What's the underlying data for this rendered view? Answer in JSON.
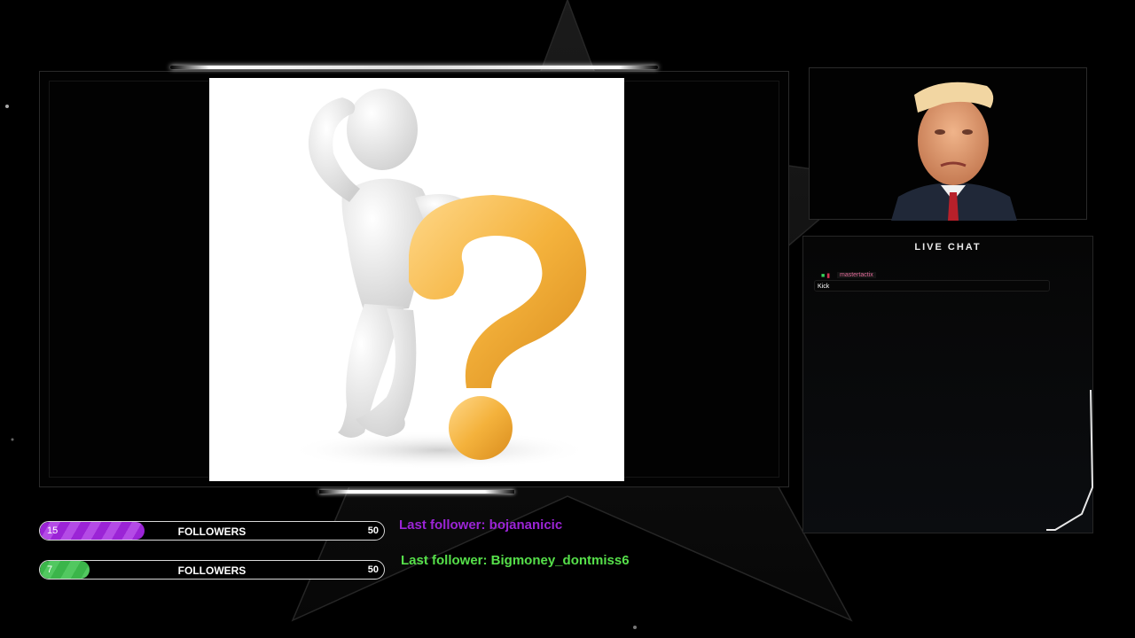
{
  "chat": {
    "title": "LIVE CHAT",
    "messages": [
      {
        "user": "mastertactix",
        "text": "Kick"
      }
    ]
  },
  "goals": [
    {
      "current": "15",
      "label": "FOLLOWERS",
      "target": "50",
      "progress": 0.3,
      "color": "#9b24d6"
    },
    {
      "current": "7",
      "label": "FOLLOWERS",
      "target": "50",
      "progress": 0.14,
      "color": "#3bb54a"
    }
  ],
  "last_followers": [
    {
      "text": "Last follower: bojananicic",
      "color": "#9b24d6"
    },
    {
      "text": "Last follower: Bigmoney_dontmiss6",
      "color": "#56e04a"
    }
  ],
  "icons": [
    "question-mark-figure-image",
    "webcam-avatar-image"
  ]
}
